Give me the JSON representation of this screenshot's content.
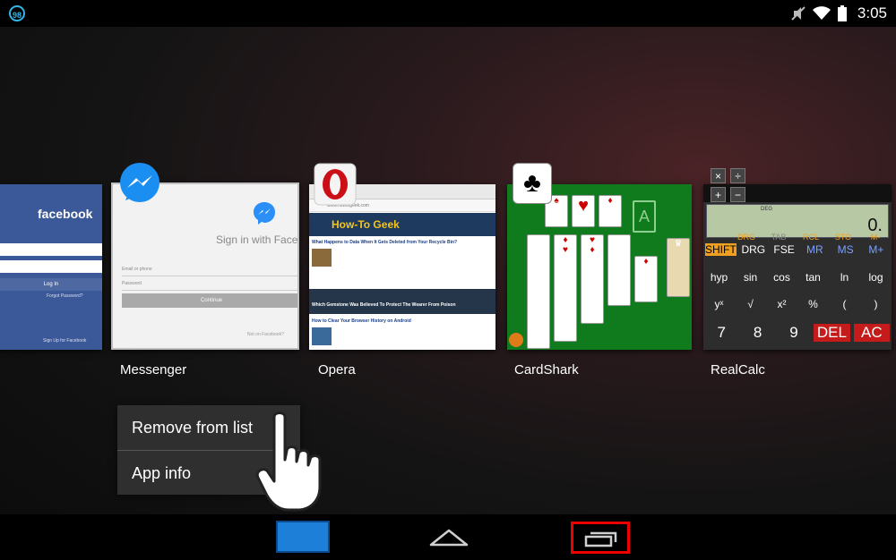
{
  "status_bar": {
    "notification_badge": "98",
    "time": "3:05",
    "icons": [
      "mute-icon",
      "wifi-icon",
      "battery-icon"
    ]
  },
  "recent_apps": [
    {
      "label": "",
      "preview": {
        "logo": "facebook",
        "login_button": "Log In",
        "forgot": "Forgot Password?",
        "signup": "Sign Up for Facebook"
      }
    },
    {
      "label": "Messenger",
      "preview": {
        "heading": "Sign in with Faceb",
        "email_placeholder": "Email or phone",
        "password_placeholder": "Password",
        "continue": "Continue",
        "footer": "Not on Facebook?"
      }
    },
    {
      "label": "Opera",
      "preview": {
        "url": "www.howtogeek.com",
        "site": "How-To Geek",
        "headlines": [
          "What Happens to Data When It Gets Deleted from Your Recycle Bin?",
          "Which Gemstone Was Believed To Protect The Wearer From Poison",
          "How to Clear Your Browser History on Android"
        ]
      }
    },
    {
      "label": "CardShark",
      "preview": {
        "foundation": "A"
      }
    },
    {
      "label": "RealCalc",
      "preview": {
        "mode": "DEG",
        "display": "0.",
        "row1": [
          "DRG",
          "TAB",
          "RCL",
          "STO",
          "M-"
        ],
        "row2": [
          "SHIFT",
          "DRG",
          "FSE",
          "MR",
          "MS",
          "M+"
        ],
        "row3": [
          "hyp",
          "sin",
          "cos",
          "tan",
          "ln",
          "log"
        ],
        "row4": [
          "yˣ",
          "√",
          "x²",
          "%",
          "(",
          ")"
        ],
        "row5": [
          "7",
          "8",
          "9",
          "DEL",
          "AC"
        ]
      }
    }
  ],
  "context_menu": {
    "items": [
      "Remove from list",
      "App info"
    ]
  },
  "colors": {
    "highlight_box": "#ee0000",
    "home_button": "#1e7fd8",
    "menu_bg": "#2f2f2f"
  }
}
